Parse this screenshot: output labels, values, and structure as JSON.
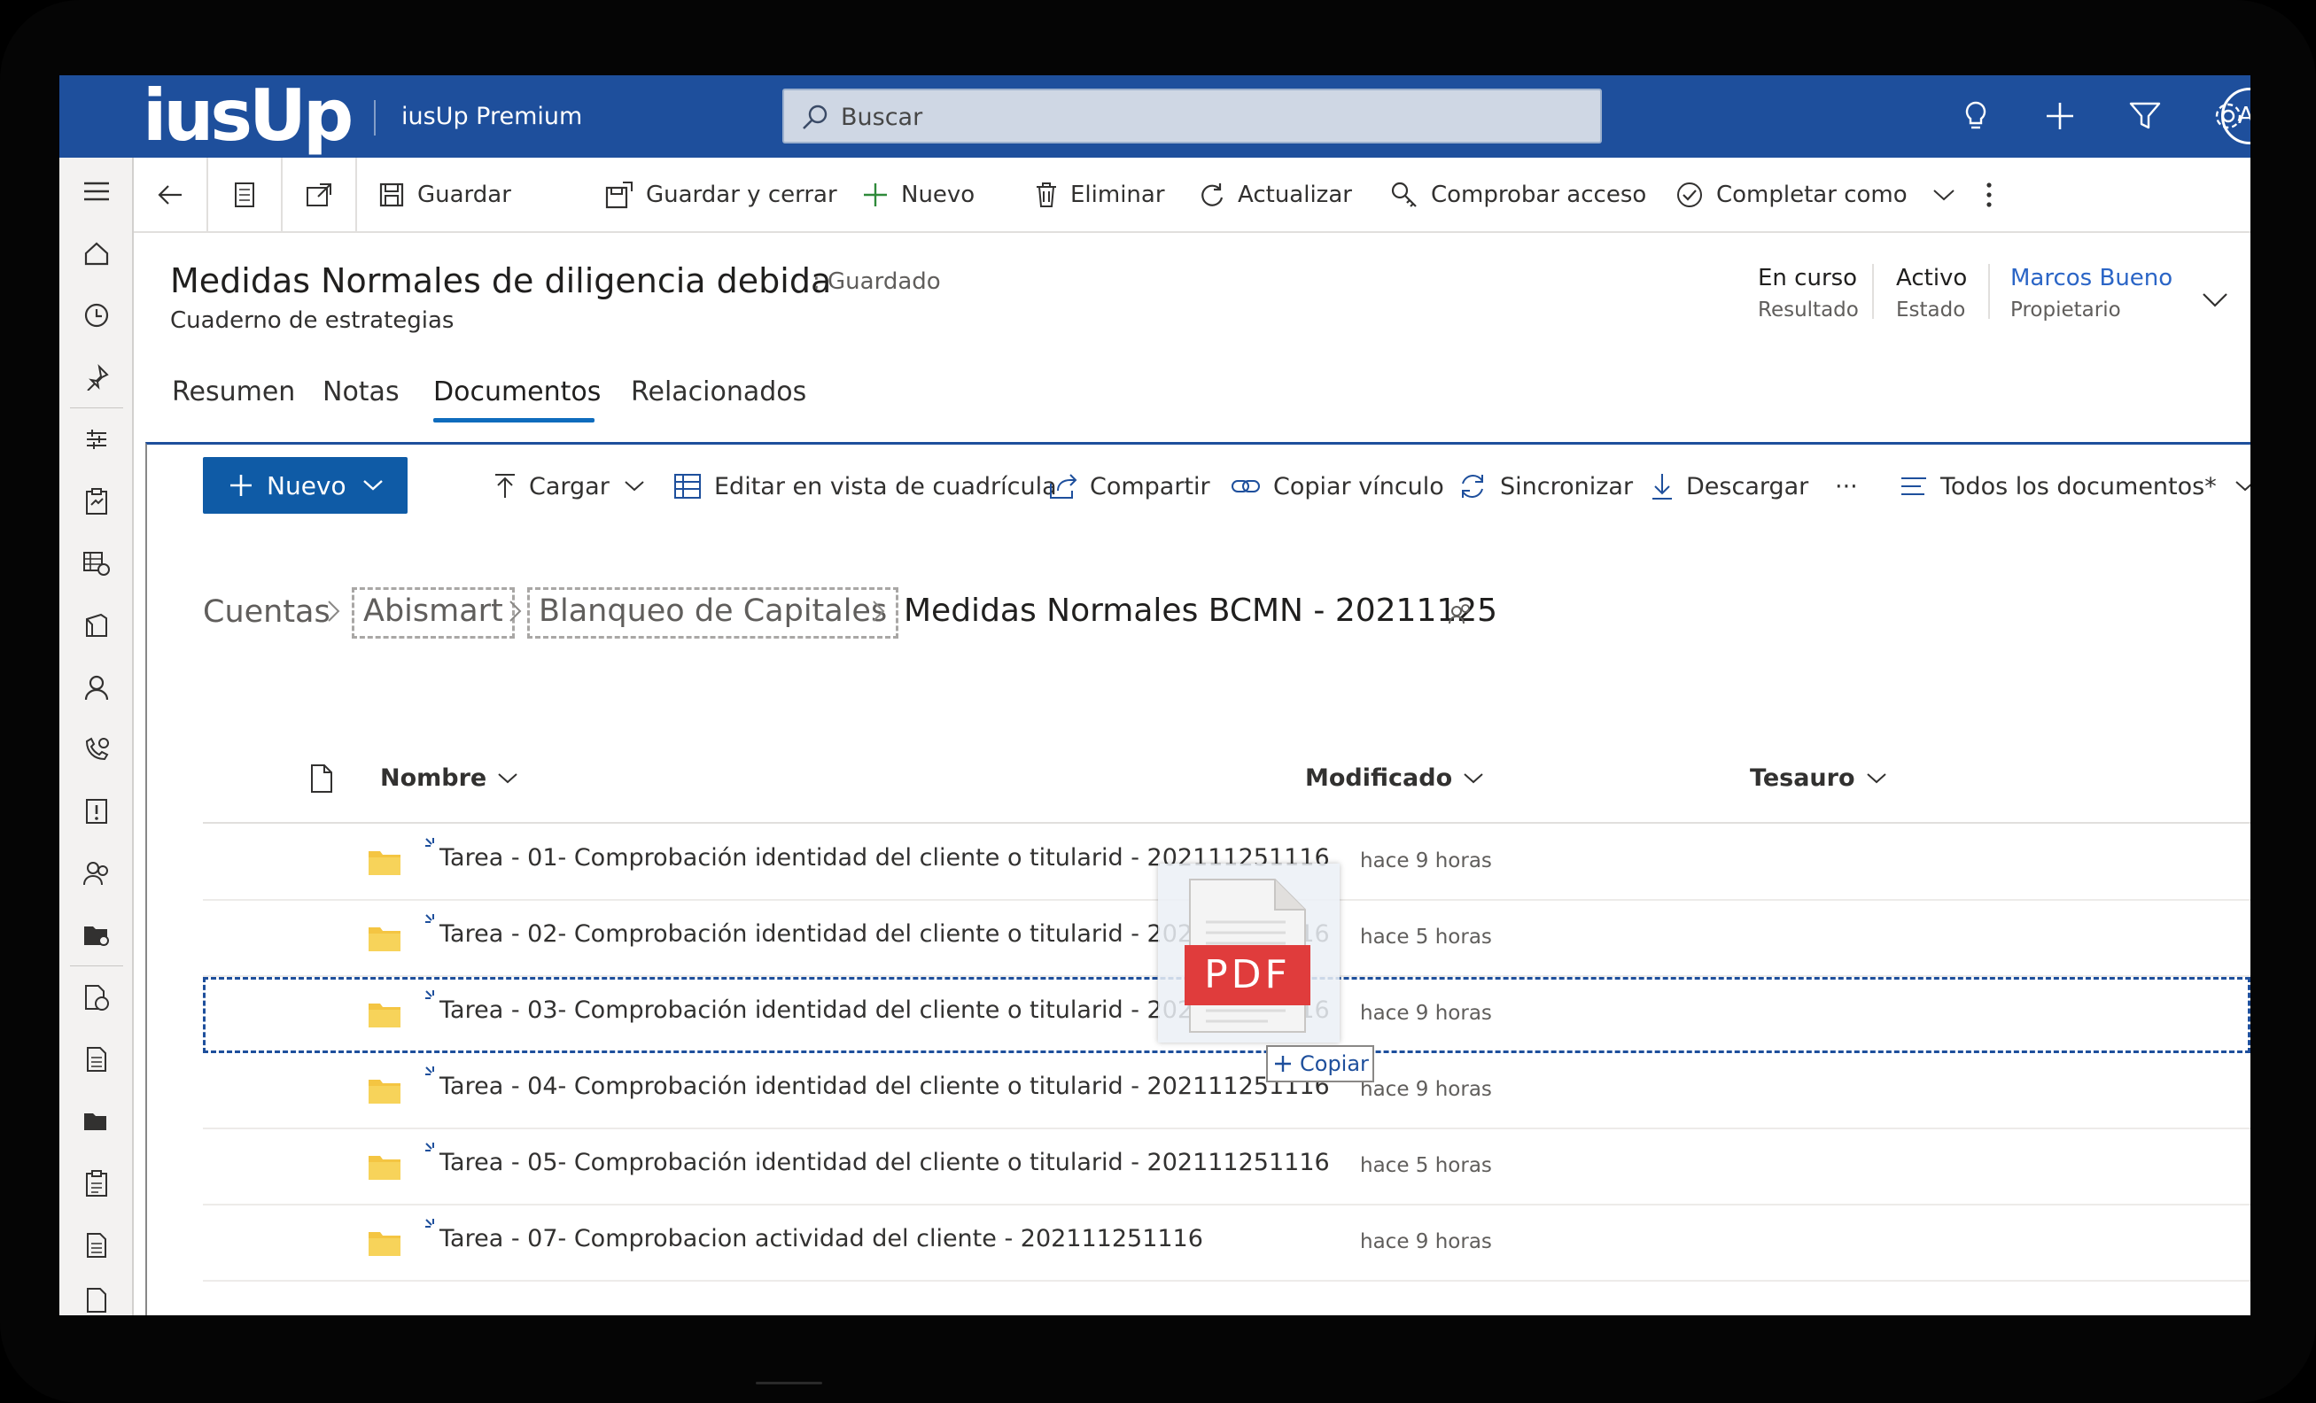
{
  "app": {
    "logo_text": "iusUp",
    "name": "iusUp Premium"
  },
  "search": {
    "placeholder": "Buscar"
  },
  "top_icons": [
    "lightbulb-icon",
    "add-icon",
    "filter-icon",
    "settings-icon",
    "help-icon"
  ],
  "user": {
    "initial": "A"
  },
  "command_bar": {
    "save": "Guardar",
    "save_close": "Guardar y cerrar",
    "new": "Nuevo",
    "delete": "Eliminar",
    "refresh": "Actualizar",
    "check_access": "Comprobar acceso",
    "complete_as": "Completar como"
  },
  "record": {
    "title": "Medidas Normales de diligencia debida",
    "saved_status": ": Guardado",
    "entity": "Cuaderno de estrategias",
    "fields": [
      {
        "value": "En curso",
        "label": "Resultado"
      },
      {
        "value": "Activo",
        "label": "Estado"
      },
      {
        "value": "Marcos Bueno",
        "label": "Propietario"
      }
    ]
  },
  "tabs": [
    "Resumen",
    "Notas",
    "Documentos",
    "Relacionados"
  ],
  "active_tab": "Documentos",
  "doc_commands": {
    "new": "Nuevo",
    "upload": "Cargar",
    "edit_grid": "Editar en vista de cuadrícula",
    "share": "Compartir",
    "copy_link": "Copiar vínculo",
    "sync": "Sincronizar",
    "download": "Descargar",
    "more": "···",
    "view": "Todos los documentos*"
  },
  "breadcrumb": {
    "items": [
      "Cuentas",
      "Abismart",
      "Blanqueo de Capitales"
    ],
    "current": "Medidas Normales BCMN - 20211125"
  },
  "columns": {
    "name": "Nombre",
    "modified": "Modificado",
    "thesaurus": "Tesauro"
  },
  "rows": [
    {
      "name": "Tarea - 01- Comprobación identidad del cliente o titularid - 202111251116",
      "modified": "hace 9 horas"
    },
    {
      "name": "Tarea - 02- Comprobación identidad del cliente o titularid - 202111251116",
      "modified": "hace 5 horas"
    },
    {
      "name": "Tarea - 03- Comprobación identidad del cliente o titularid - 202111251116",
      "modified": "hace 9 horas"
    },
    {
      "name": "Tarea - 04- Comprobación identidad del cliente o titularid - 202111251116",
      "modified": "hace 9 horas"
    },
    {
      "name": "Tarea - 05- Comprobación identidad del cliente o titularid - 202111251116",
      "modified": "hace 5 horas"
    },
    {
      "name": "Tarea - 07- Comprobacion actividad del cliente - 202111251116",
      "modified": "hace 9 horas"
    }
  ],
  "drag": {
    "file_type": "PDF",
    "tooltip": "Copiar"
  },
  "colors": {
    "brand_bar": "#1e4f9c",
    "primary_button": "#0f5ba6",
    "folder": "#f4c542",
    "pdf": "#e03c3c",
    "link": "#2b65c6"
  }
}
